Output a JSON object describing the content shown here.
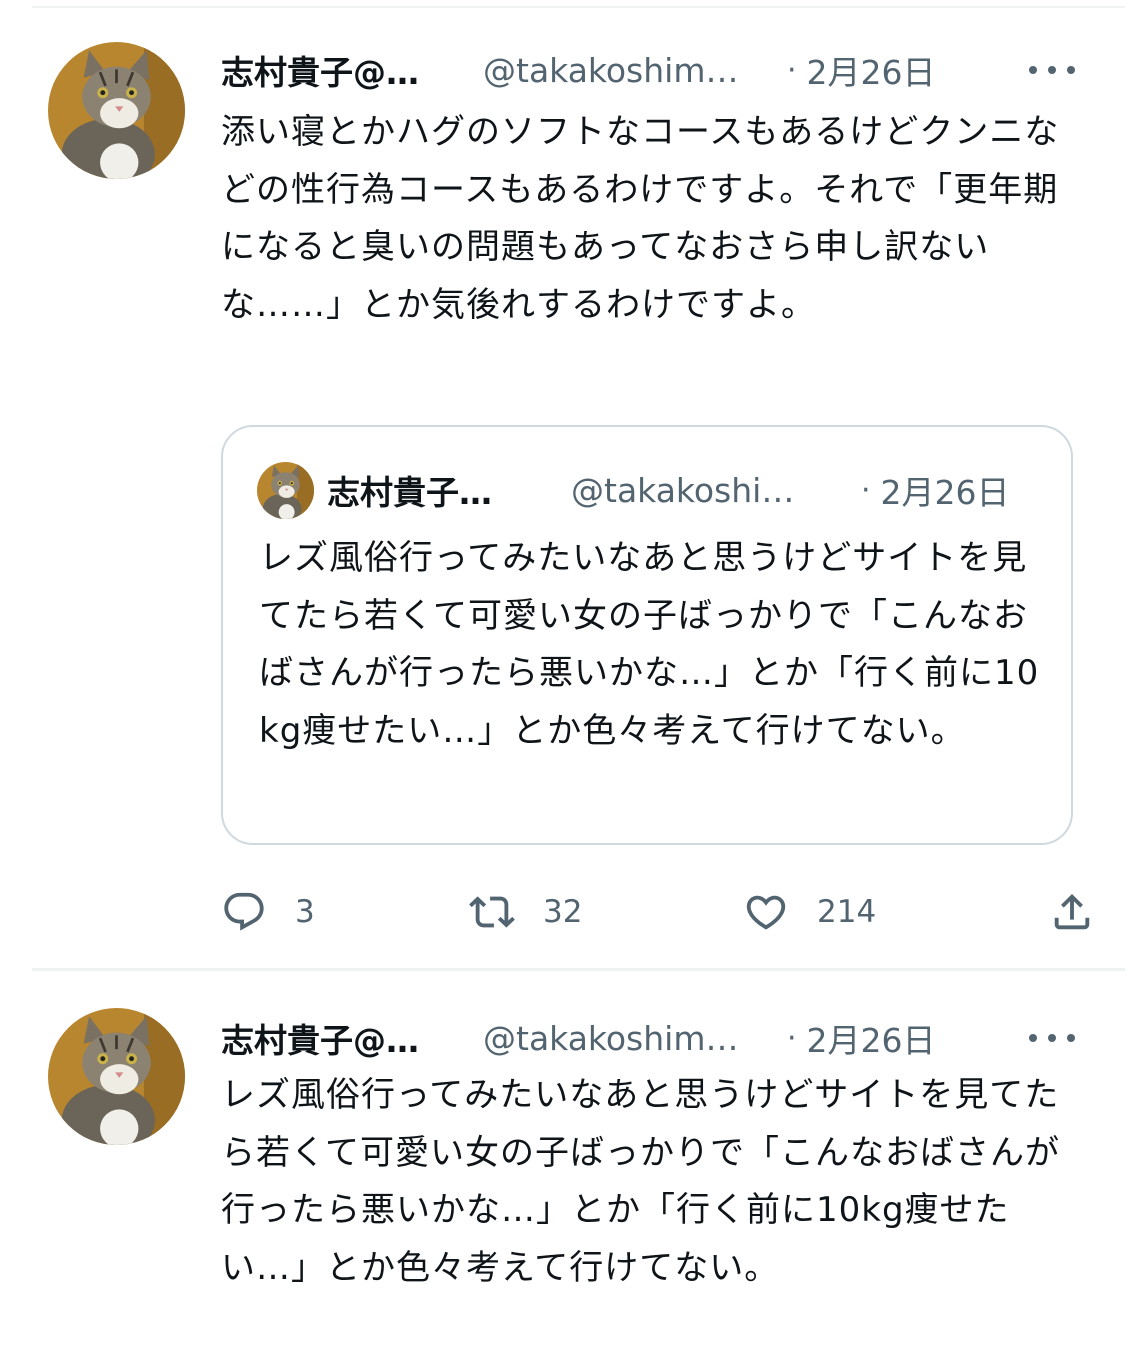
{
  "tweets": [
    {
      "author": {
        "name": "志村貴子@…",
        "handle": "@takakoshim…",
        "avatar_icon": "cat-avatar"
      },
      "separator": "·",
      "date": "2月26日",
      "text": "添い寝とかハグのソフトなコースもあるけどクンニなどの性行為コースもあるわけですよ。それで「更年期になると臭いの問題もあってなおさら申し訳ないな……」とか気後れするわけですよ。",
      "quote": {
        "author": {
          "name": "志村貴子…",
          "handle": "@takakoshi…",
          "avatar_icon": "cat-avatar"
        },
        "separator": "·",
        "date": "2月26日",
        "text": "レズ風俗行ってみたいなあと思うけどサイトを見てたら若くて可愛い女の子ばっかりで「こんなおばさんが行ったら悪いかな…」とか「行く前に10kg痩せたい…」とか色々考えて行けてない。"
      },
      "actions": {
        "reply_count": "3",
        "retweet_count": "32",
        "like_count": "214"
      }
    },
    {
      "author": {
        "name": "志村貴子@…",
        "handle": "@takakoshim…",
        "avatar_icon": "cat-avatar"
      },
      "separator": "·",
      "date": "2月26日",
      "text": "レズ風俗行ってみたいなあと思うけどサイトを見てたら若くて可愛い女の子ばっかりで「こんなおばさんが行ったら悪いかな…」とか「行く前に10kg痩せたい…」とか色々考えて行けてない。"
    }
  ],
  "icons": {
    "more": "more-horizontal-icon",
    "reply": "reply-bubble-icon",
    "retweet": "retweet-arrows-icon",
    "like": "heart-icon",
    "share": "share-upload-icon"
  },
  "colors": {
    "text": "#0f1419",
    "secondary": "#536471",
    "border": "#cfd9de",
    "divider": "#eff3f4"
  }
}
